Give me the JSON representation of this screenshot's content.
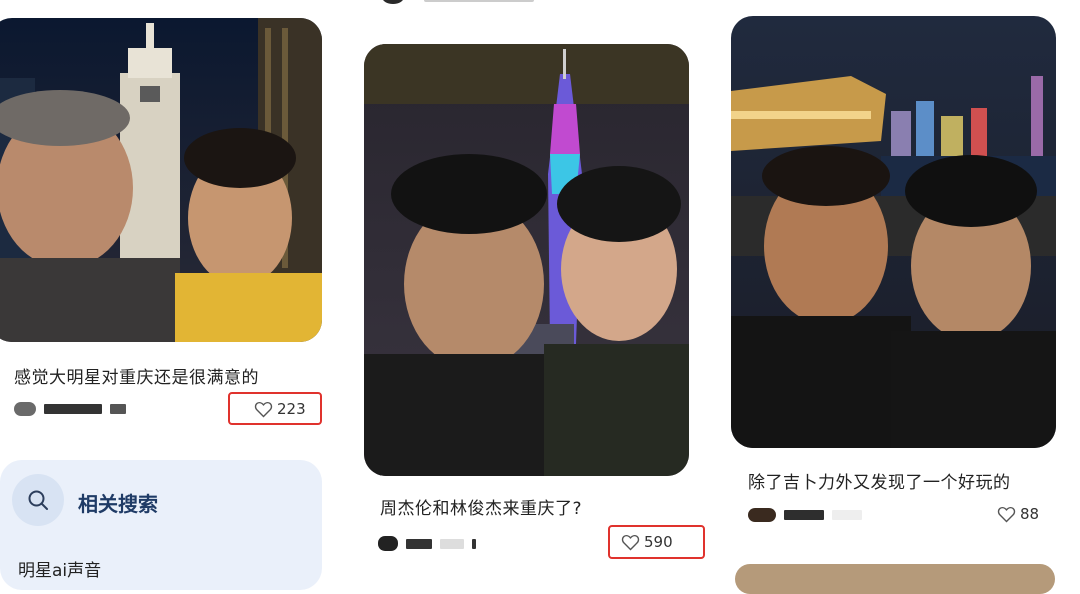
{
  "feed": {
    "cards": [
      {
        "title": "感觉大明星对重庆还是很满意的",
        "likes": "223",
        "image": "selfie-chongqing-clock-tower"
      },
      {
        "title": "周杰伦和林俊杰来重庆了?",
        "likes": "590",
        "image": "selfie-canton-tower-night"
      },
      {
        "title": "除了吉卜力外又发现了一个好玩的",
        "likes": "88",
        "image": "selfie-harbour-night"
      }
    ]
  },
  "related": {
    "title": "相关搜索",
    "first_item": "明星ai声音",
    "icon": "search-icon"
  },
  "colors": {
    "highlight": "#e0322d",
    "related_bg": "#eaf0fa",
    "related_title": "#1f3b66"
  }
}
